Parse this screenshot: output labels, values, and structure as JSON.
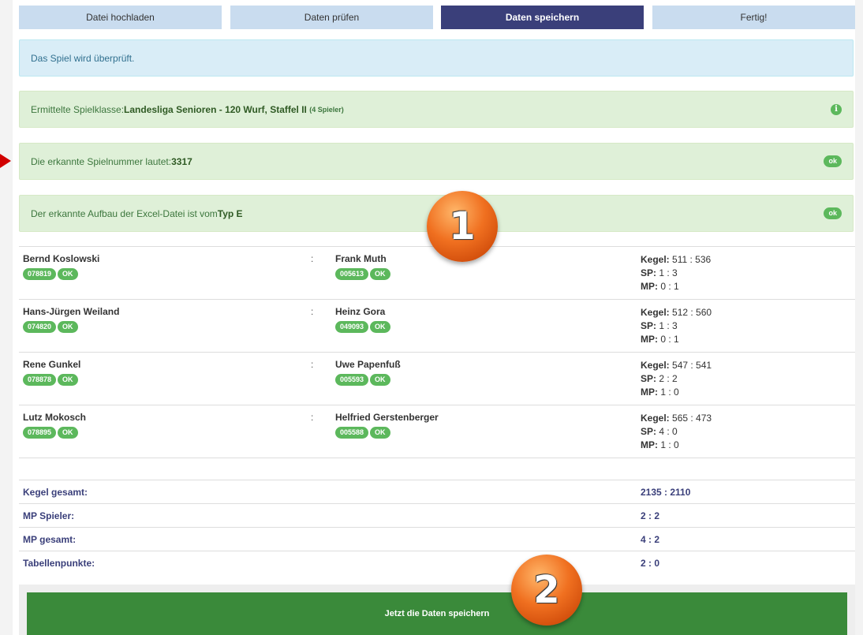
{
  "steps": [
    {
      "label": "Datei hochladen",
      "active": false
    },
    {
      "label": "Daten prüfen",
      "active": false
    },
    {
      "label": "Daten speichern",
      "active": true
    },
    {
      "label": "Fertig!",
      "active": false
    }
  ],
  "alerts": {
    "checking": "Das Spiel wird überprüft.",
    "class_prefix": "Ermittelte Spielklasse: ",
    "class_value": "Landesliga Senioren - 120 Wurf, Staffel II",
    "class_small": "(4 Spieler)",
    "class_icon": "info-icon",
    "number_prefix": "Die erkannte Spielnummer lautet: ",
    "number_value": "3317",
    "number_badge": "ok",
    "type_prefix": "Der erkannte Aufbau der Excel-Datei ist vom ",
    "type_value": "Typ E",
    "type_badge": "ok"
  },
  "games": [
    {
      "home": "Bernd Koslowski",
      "home_id": "078819",
      "away": "Frank Muth",
      "away_id": "005613",
      "kegel_label": "Kegel:",
      "kegel": "511 : 536",
      "sp_label": "SP:",
      "sp": "1 : 3",
      "mp_label": "MP:",
      "mp": "0 : 1"
    },
    {
      "home": "Hans-Jürgen Weiland",
      "home_id": "074820",
      "away": "Heinz Gora",
      "away_id": "049093",
      "kegel_label": "Kegel:",
      "kegel": "512 : 560",
      "sp_label": "SP:",
      "sp": "1 : 3",
      "mp_label": "MP:",
      "mp": "0 : 1"
    },
    {
      "home": "Rene Gunkel",
      "home_id": "078878",
      "away": "Uwe Papenfuß",
      "away_id": "005593",
      "kegel_label": "Kegel:",
      "kegel": "547 : 541",
      "sp_label": "SP:",
      "sp": "2 : 2",
      "mp_label": "MP:",
      "mp": "1 : 0"
    },
    {
      "home": "Lutz Mokosch",
      "home_id": "078895",
      "away": "Helfried Gerstenberger",
      "away_id": "005588",
      "kegel_label": "Kegel:",
      "kegel": "565 : 473",
      "sp_label": "SP:",
      "sp": "4 : 0",
      "mp_label": "MP:",
      "mp": "1 : 0"
    }
  ],
  "ok_label": "OK",
  "colon": ":",
  "summary": [
    {
      "label": "Kegel gesamt:",
      "value": "2135 : 2110"
    },
    {
      "label": "MP Spieler:",
      "value": "2 : 2"
    },
    {
      "label": "MP gesamt:",
      "value": "4 : 2"
    },
    {
      "label": "Tabellenpunkte:",
      "value": "2 : 0"
    }
  ],
  "save_button": "Jetzt die Daten speichern",
  "markers": [
    "1",
    "2"
  ],
  "colors": {
    "active_step": "#3a3f7a",
    "step": "#c9dcef",
    "success": "#dff0d8",
    "info": "#d9edf7",
    "pill": "#5cb85c",
    "save": "#3a8a3a",
    "marker": "#f07020",
    "arrow": "#d10000"
  }
}
